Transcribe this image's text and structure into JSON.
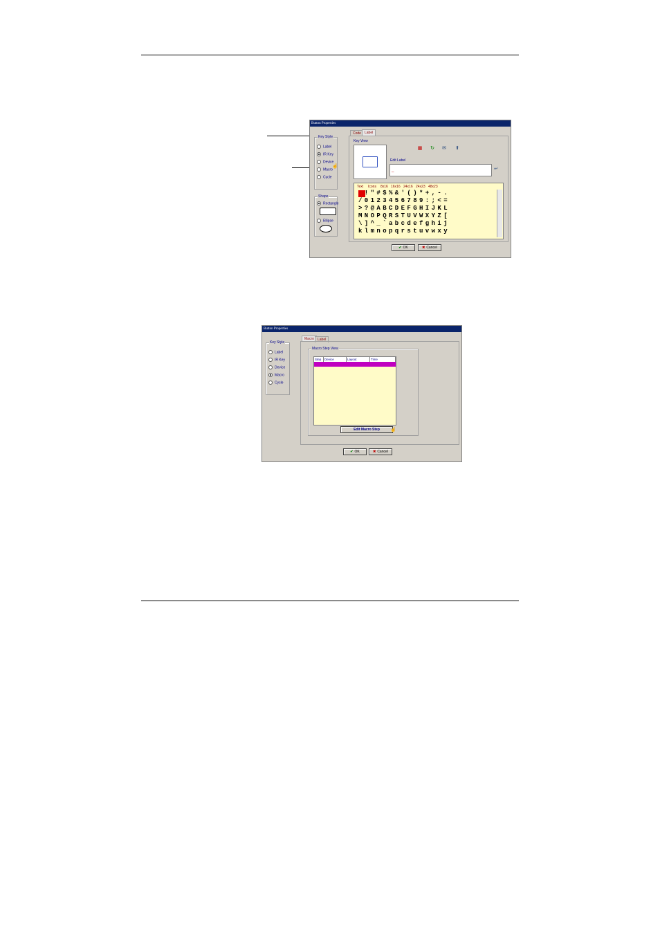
{
  "dialog1": {
    "title": "Button Properties",
    "key_style": {
      "label": "Key Style",
      "options": [
        "Label",
        "IR Key",
        "Device",
        "Macro",
        "Cycle"
      ]
    },
    "shape": {
      "label": "Shape",
      "options": [
        "Rectangle",
        "Ellipse"
      ]
    },
    "tabs": [
      "Code",
      "Label"
    ],
    "key_view_label": "Key View",
    "edit_label": "Edit Label",
    "char_tabs": [
      "Text",
      "Icons",
      "8x16",
      "16x16",
      "24x16",
      "24x23",
      "48x23"
    ],
    "char_rows": [
      " !\"#$%&'()*+,-.",
      "/0123456789:;<=",
      ">?@ABCDEFGHIJKL",
      "MNOPQRSTUVWXYZ[",
      "\\]^_`abcdefghij",
      "klmnopqrstuvwxy"
    ],
    "ok_label": "OK",
    "cancel_label": "Cancel"
  },
  "dialog2": {
    "title": "Button Properties",
    "tabs": [
      "Macro",
      "Label"
    ],
    "key_style": {
      "label": "Key Style",
      "options": [
        "Label",
        "IR Key",
        "Device",
        "Macro",
        "Cycle"
      ]
    },
    "macro_step_view_label": "Macro Step View",
    "columns": [
      "Step",
      "Device",
      "Layout",
      "Time"
    ],
    "edit_macro_step_label": "Edit Macro Step",
    "ok_label": "OK",
    "cancel_label": "Cancel"
  }
}
